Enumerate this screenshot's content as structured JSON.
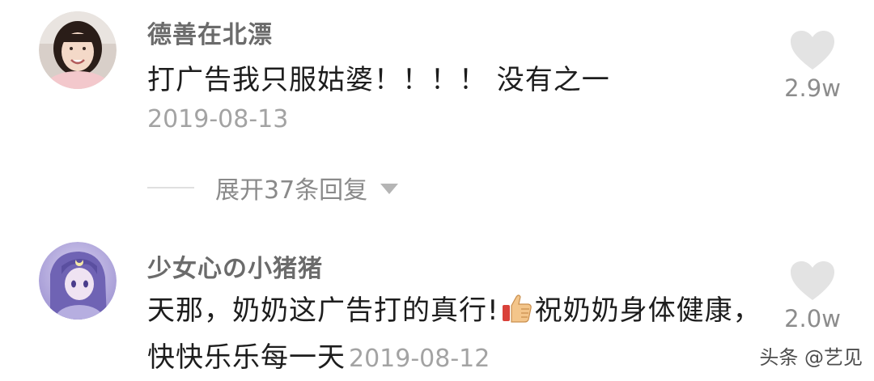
{
  "comments": [
    {
      "username": "德善在北漂",
      "text": "打广告我只服姑婆！！！！ 没有之一",
      "date": "2019-08-13",
      "likes": "2.9w",
      "avatar_icon": "avatar-girl-photo"
    },
    {
      "username": "少女心の小猪猪",
      "text_before_emoji": "天那，奶奶这广告打的真行!",
      "emoji_icon": "thumbs-up-icon",
      "text_after_emoji": "祝奶奶身体健康，快快乐乐每一天",
      "date": "2019-08-12",
      "likes": "2.0w",
      "avatar_icon": "avatar-anime-girl"
    }
  ],
  "expand_replies": {
    "label": "展开37条回复",
    "icon": "chevron-down-icon"
  },
  "watermark": "头条 @艺见",
  "colors": {
    "username": "#6b6b6b",
    "text": "#1d1d1d",
    "meta": "#a3a3a3",
    "heart": "#e3e3e3"
  }
}
